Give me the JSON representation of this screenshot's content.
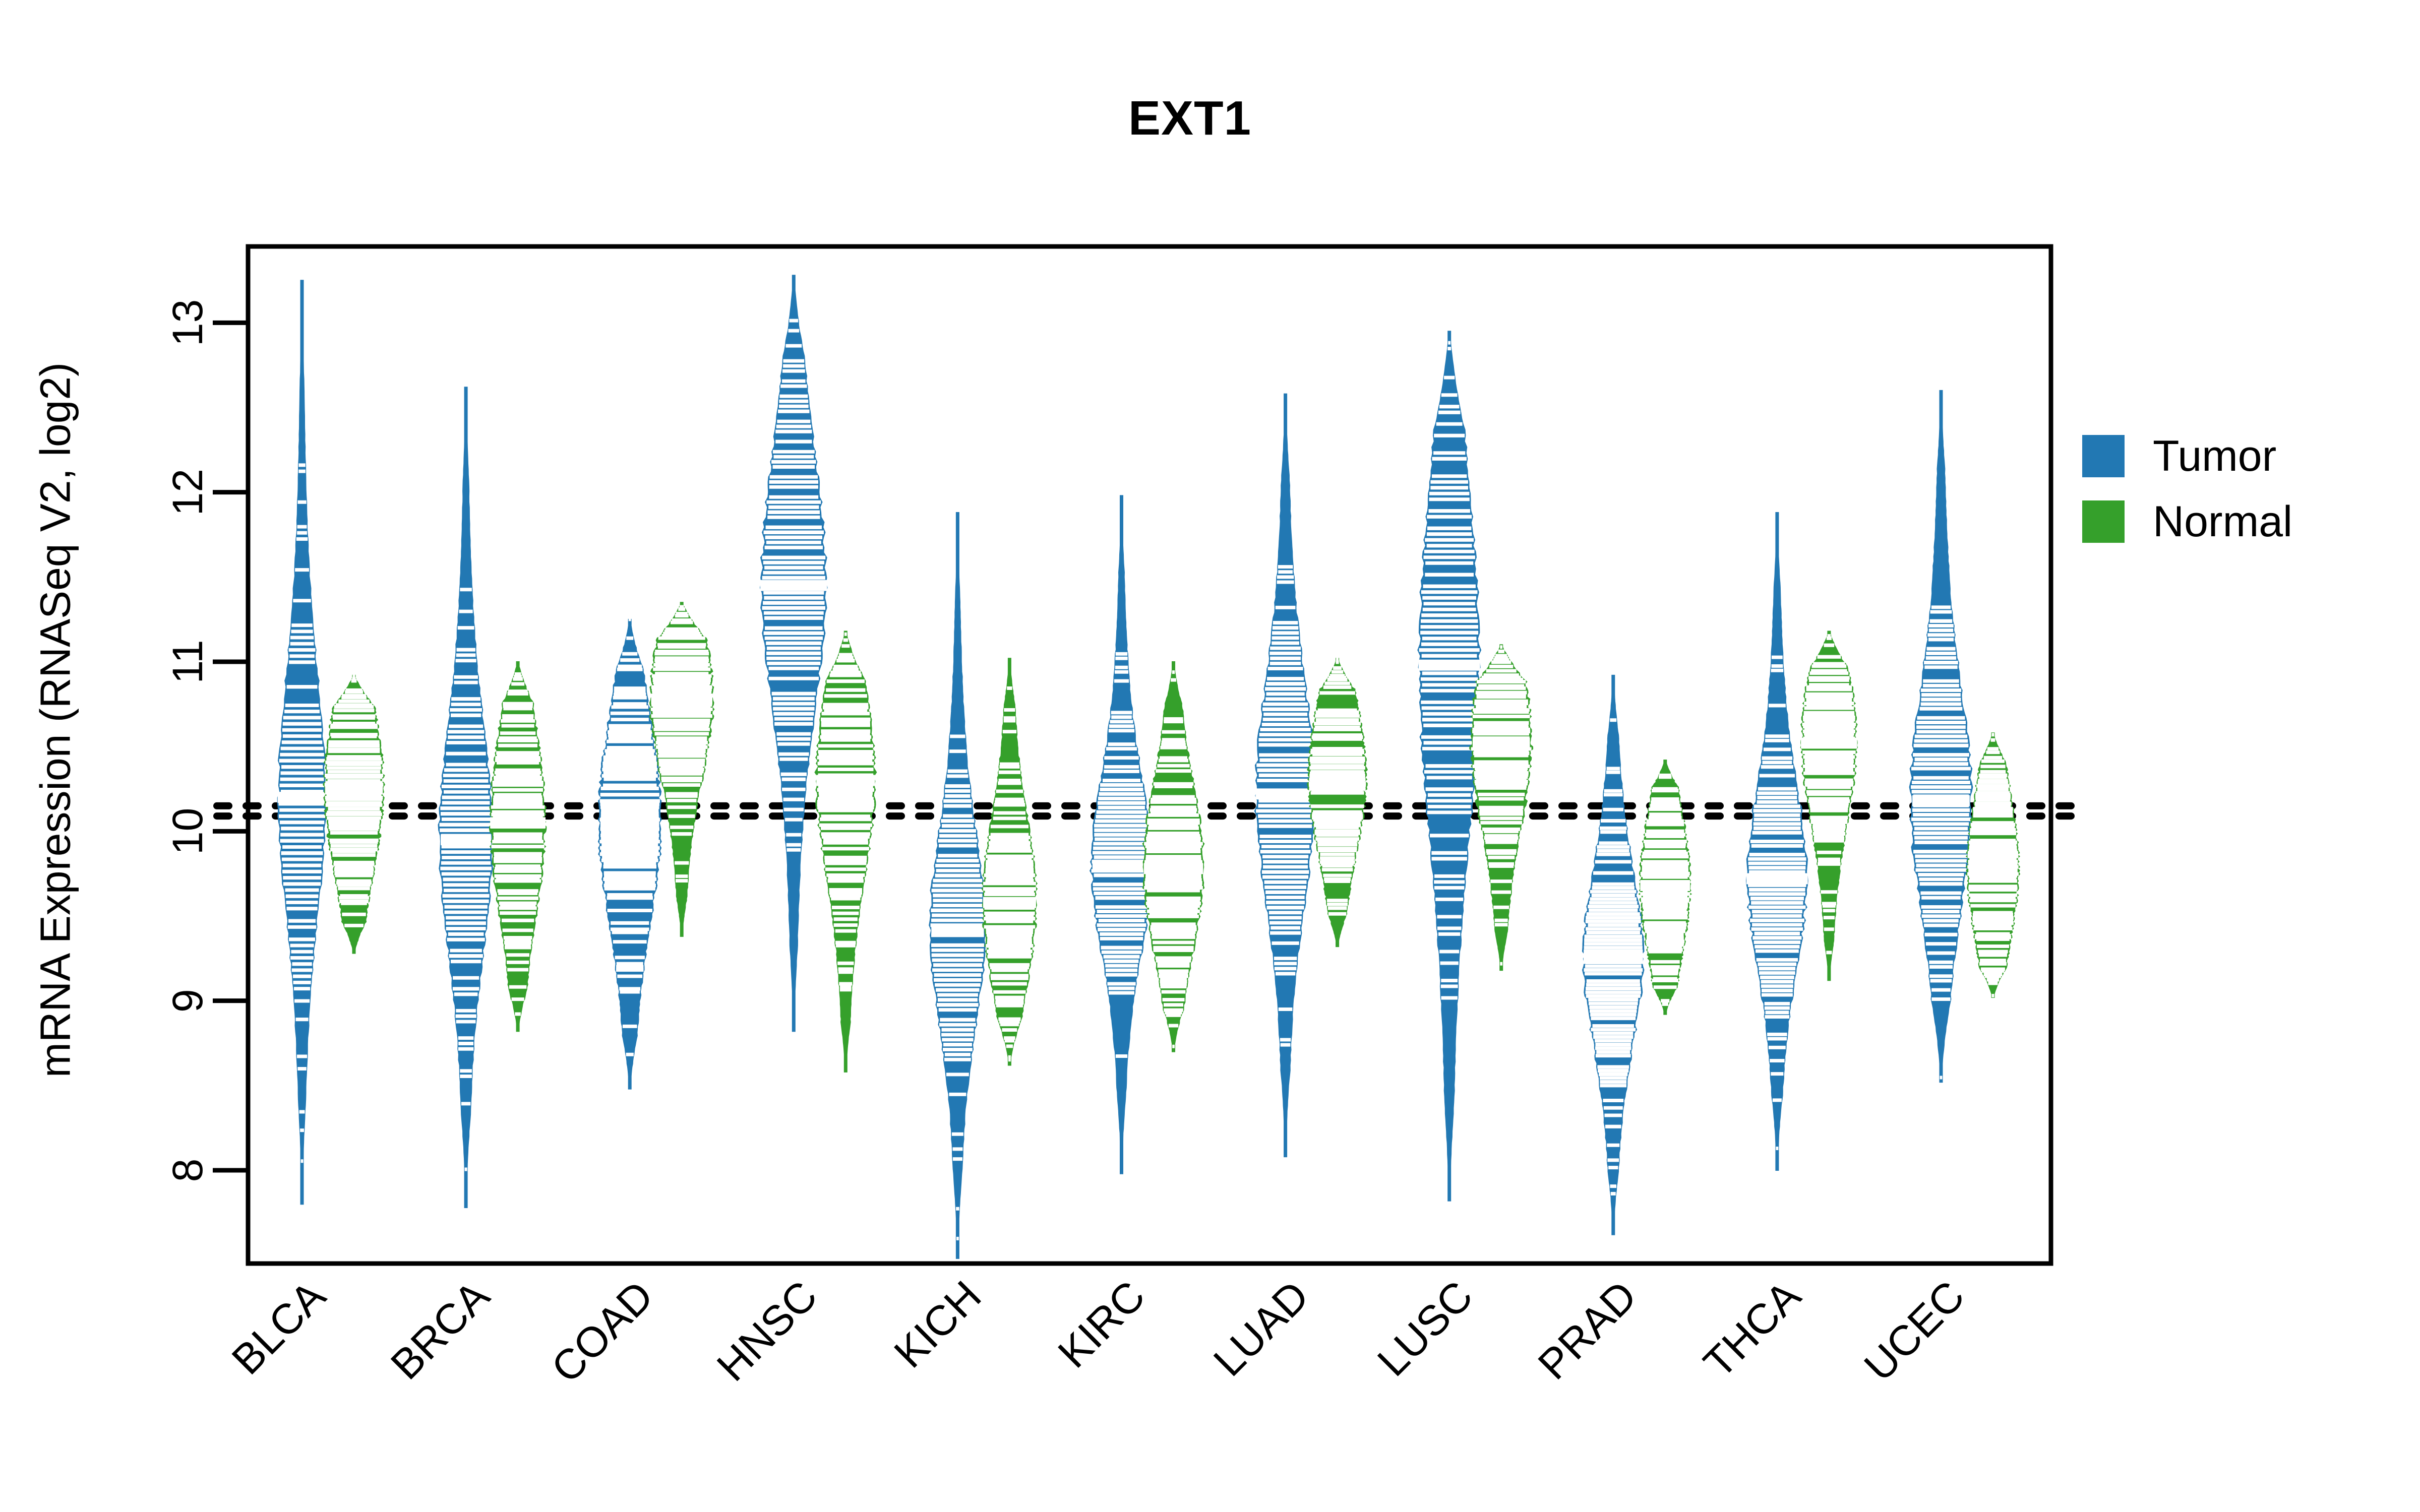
{
  "chart": {
    "title": "EXT1",
    "ylabel": "mRNA Expression (RNASeq V2, log2)",
    "legend": [
      {
        "label": "Tumor",
        "color": "#2278b3",
        "key": "tumor"
      },
      {
        "label": "Normal",
        "color": "#35a02b",
        "key": "normal"
      }
    ]
  },
  "chart_data": {
    "type": "violin",
    "title": "EXT1",
    "xlabel": "",
    "ylabel": "mRNA Expression (RNASeq V2, log2)",
    "ylim": [
      7.45,
      13.45
    ],
    "yticks": [
      8,
      9,
      10,
      11,
      12,
      13
    ],
    "ytick_labels": [
      "8",
      "9",
      "10",
      "11",
      "12",
      "13"
    ],
    "grid": false,
    "legend_position": "right",
    "reference_lines": [
      {
        "value": 10.15,
        "style": "dotted",
        "color": "#000000"
      },
      {
        "value": 10.09,
        "style": "dotted",
        "color": "#000000"
      }
    ],
    "categories": [
      "BLCA",
      "BRCA",
      "COAD",
      "HNSC",
      "KICH",
      "KIRC",
      "LUAD",
      "LUSC",
      "PRAD",
      "THCA",
      "UCEC"
    ],
    "series": [
      {
        "name": "Tumor",
        "color": "#2278b3",
        "values": [
          {
            "category": "BLCA",
            "median": 10.2,
            "q1": 9.8,
            "q3": 10.65,
            "min": 7.8,
            "max": 13.25,
            "width": 0.62
          },
          {
            "category": "BRCA",
            "median": 9.95,
            "q1": 9.62,
            "q3": 10.42,
            "min": 7.78,
            "max": 12.62,
            "width": 0.7
          },
          {
            "category": "COAD",
            "median": 10.05,
            "q1": 9.7,
            "q3": 10.42,
            "min": 8.48,
            "max": 11.25,
            "width": 0.8
          },
          {
            "category": "HNSC",
            "median": 11.45,
            "q1": 11.0,
            "q3": 11.9,
            "min": 8.82,
            "max": 13.28,
            "width": 0.85
          },
          {
            "category": "KICH",
            "median": 9.42,
            "q1": 9.12,
            "q3": 9.8,
            "min": 7.48,
            "max": 11.88,
            "width": 0.72
          },
          {
            "category": "KIRC",
            "median": 9.8,
            "q1": 9.5,
            "q3": 10.12,
            "min": 7.98,
            "max": 11.98,
            "width": 0.8
          },
          {
            "category": "LUAD",
            "median": 10.22,
            "q1": 9.85,
            "q3": 10.62,
            "min": 8.08,
            "max": 12.58,
            "width": 0.78
          },
          {
            "category": "LUSC",
            "median": 10.98,
            "q1": 10.4,
            "q3": 11.62,
            "min": 7.82,
            "max": 12.95,
            "width": 0.8
          },
          {
            "category": "PRAD",
            "median": 9.25,
            "q1": 8.95,
            "q3": 9.58,
            "min": 7.62,
            "max": 10.92,
            "width": 0.78
          },
          {
            "category": "THCA",
            "median": 9.72,
            "q1": 9.4,
            "q3": 10.05,
            "min": 8.0,
            "max": 11.88,
            "width": 0.78
          },
          {
            "category": "UCEC",
            "median": 10.18,
            "q1": 9.82,
            "q3": 10.6,
            "min": 8.52,
            "max": 12.6,
            "width": 0.8
          }
        ]
      },
      {
        "name": "Normal",
        "color": "#35a02b",
        "values": [
          {
            "category": "BLCA",
            "median": 10.25,
            "q1": 9.92,
            "q3": 10.52,
            "min": 9.28,
            "max": 10.92,
            "width": 0.78
          },
          {
            "category": "BRCA",
            "median": 10.05,
            "q1": 9.72,
            "q3": 10.4,
            "min": 8.82,
            "max": 11.0,
            "width": 0.72
          },
          {
            "category": "COAD",
            "median": 10.78,
            "q1": 10.48,
            "q3": 11.05,
            "min": 9.38,
            "max": 11.35,
            "width": 0.82
          },
          {
            "category": "HNSC",
            "median": 10.3,
            "q1": 10.0,
            "q3": 10.68,
            "min": 8.58,
            "max": 11.18,
            "width": 0.78
          },
          {
            "category": "KICH",
            "median": 9.58,
            "q1": 9.32,
            "q3": 9.9,
            "min": 8.62,
            "max": 11.02,
            "width": 0.7
          },
          {
            "category": "KIRC",
            "median": 9.78,
            "q1": 9.5,
            "q3": 10.08,
            "min": 8.7,
            "max": 11.0,
            "width": 0.78
          },
          {
            "category": "LUAD",
            "median": 10.32,
            "q1": 10.05,
            "q3": 10.6,
            "min": 9.32,
            "max": 11.02,
            "width": 0.76
          },
          {
            "category": "LUSC",
            "median": 10.52,
            "q1": 10.22,
            "q3": 10.82,
            "min": 9.18,
            "max": 11.1,
            "width": 0.8
          },
          {
            "category": "PRAD",
            "median": 9.68,
            "q1": 9.42,
            "q3": 9.95,
            "min": 8.92,
            "max": 10.42,
            "width": 0.66
          },
          {
            "category": "THCA",
            "median": 10.52,
            "q1": 10.22,
            "q3": 10.8,
            "min": 9.12,
            "max": 11.18,
            "width": 0.72
          },
          {
            "category": "UCEC",
            "median": 9.78,
            "q1": 9.55,
            "q3": 10.1,
            "min": 9.02,
            "max": 10.58,
            "width": 0.68
          }
        ]
      }
    ]
  }
}
